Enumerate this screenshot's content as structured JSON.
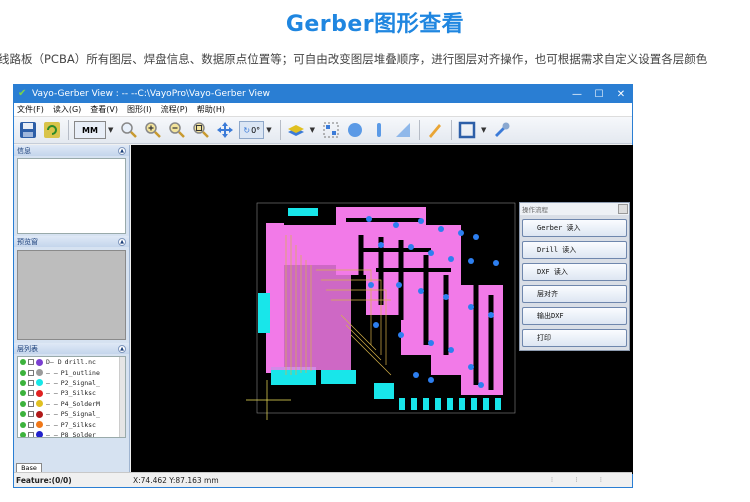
{
  "page": {
    "heading": "Gerber图形查看",
    "description": "线路板（PCBA）所有图层、焊盘信息、数据原点位置等；可自由改变图层堆叠顺序，进行图层对齐操作，也可根据需求自定义设置各层颜色"
  },
  "window": {
    "title": "Vayo-Gerber View : --   --C:\\VayoPro\\Vayo-Gerber View",
    "minimize": "—",
    "maximize": "☐",
    "close": "✕"
  },
  "menu": [
    "文件(F)",
    "读入(G)",
    "查看(V)",
    "图形(I)",
    "流程(P)",
    "帮助(H)"
  ],
  "toolbar": {
    "unit": "MM",
    "angle": "0°"
  },
  "sidebar": {
    "info_title": "信息",
    "preview_title": "预览窗",
    "layers_title": "层列表",
    "base_tab": "Base",
    "layers": [
      {
        "prefix": "D— D",
        "name": "drill.nc",
        "color": "#7a3fd0"
      },
      {
        "prefix": "— —",
        "name": "P1_outline",
        "color": "#9a9a9a"
      },
      {
        "prefix": "— —",
        "name": "P2_Signal_",
        "color": "#16e7e7"
      },
      {
        "prefix": "— —",
        "name": "P3_Silksc",
        "color": "#e02020"
      },
      {
        "prefix": "— —",
        "name": "P4_SolderM",
        "color": "#e0c020"
      },
      {
        "prefix": "— —",
        "name": "P5_Signal_",
        "color": "#b01818"
      },
      {
        "prefix": "— —",
        "name": "P7_Silksc",
        "color": "#f07818"
      },
      {
        "prefix": "— —",
        "name": "P8_Solder",
        "color": "#2222cc"
      }
    ]
  },
  "flow": {
    "title": "操作流程",
    "buttons": [
      "Gerber 读入",
      "Drill 读入",
      "DXF 读入",
      "层对齐",
      "输出DXF",
      "打印"
    ]
  },
  "status": {
    "feature": "Feature:(0/0)",
    "coord": "X:74.462 Y:87.163 mm"
  },
  "colors": {
    "accent": "#1f86e0",
    "titlebar": "#2a7ed3",
    "pcb_pink": "#f27ae8",
    "pcb_cyan": "#18e6ea",
    "pcb_pad": "#2d7ff0",
    "pcb_gold": "#d6b24a"
  }
}
